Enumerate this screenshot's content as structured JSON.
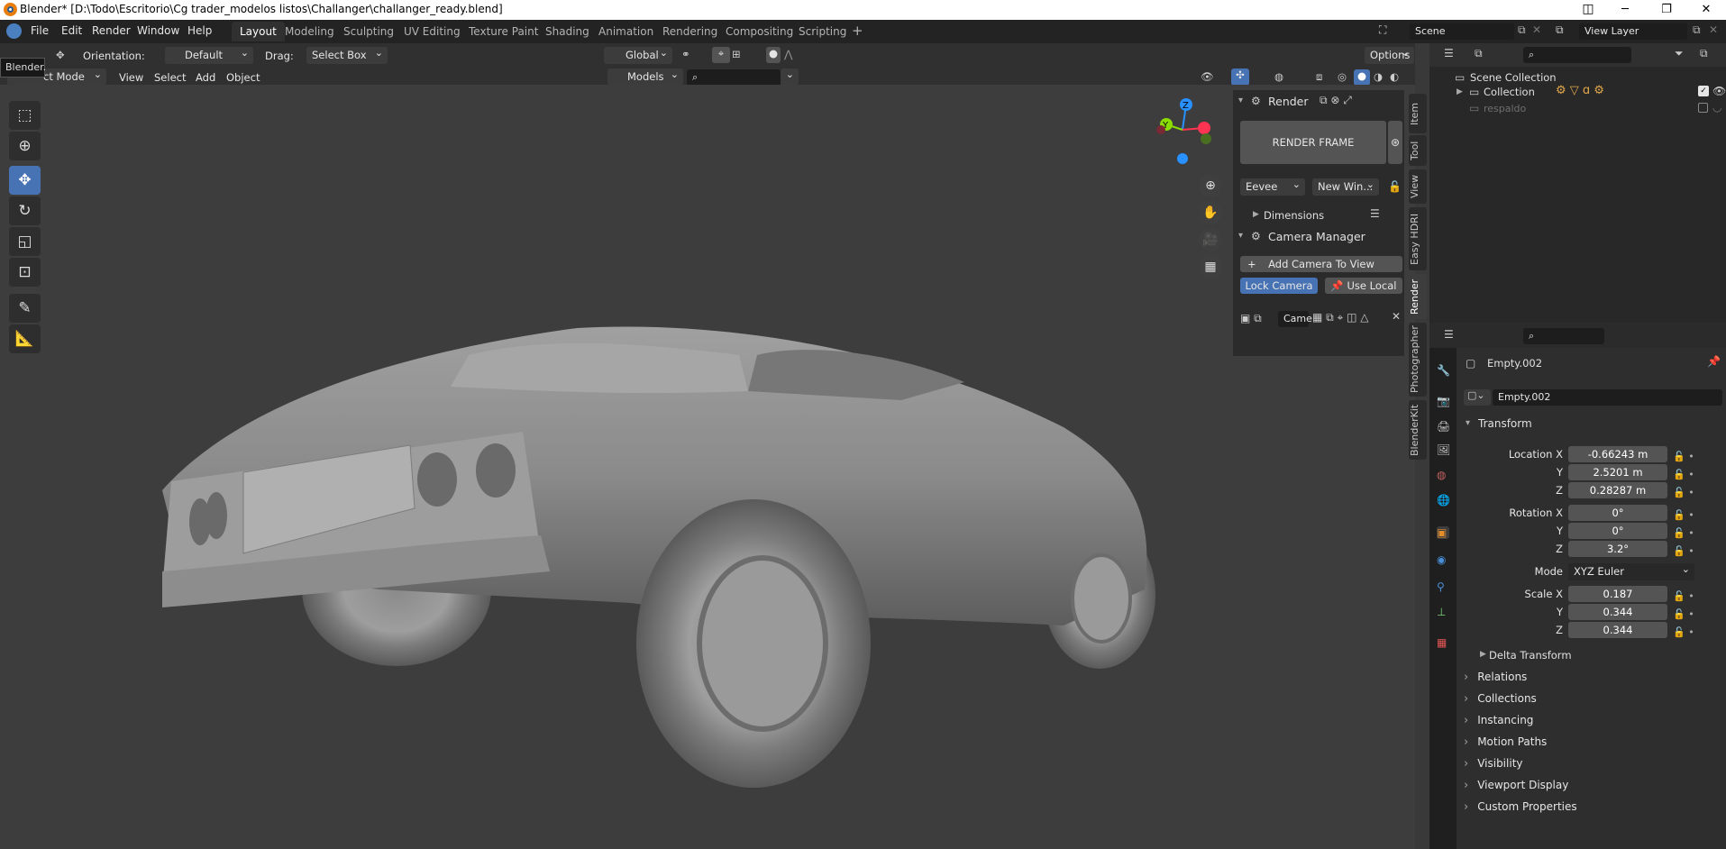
{
  "window": {
    "title": "Blender* [D:\\Todo\\Escritorio\\Cg trader_modelos listos\\Challanger\\challanger_ready.blend]",
    "minimize": "─",
    "restore": "❐",
    "close": "✕"
  },
  "menus": [
    "File",
    "Edit",
    "Render",
    "Window",
    "Help"
  ],
  "workspaces": [
    "Layout",
    "Modeling",
    "Sculpting",
    "UV Editing",
    "Texture Paint",
    "Shading",
    "Animation",
    "Rendering",
    "Compositing",
    "Scripting"
  ],
  "scene": {
    "label": "Scene"
  },
  "view_layer": {
    "label": "View Layer"
  },
  "tool_header": {
    "orientation_label": "Orientation:",
    "orientation_value": "Default",
    "drag_label": "Drag:",
    "drag_value": "Select Box",
    "transform_orientation": "Global",
    "options": "Options"
  },
  "view_header": {
    "mode": "ct Mode",
    "view": "View",
    "select": "Select",
    "add": "Add",
    "object": "Object",
    "collection_filter": "Models"
  },
  "tooltip": "Blender.",
  "render_panel": {
    "title": "Render",
    "render_frame": "RENDER FRAME",
    "engine": "Eevee",
    "output": "New Win...",
    "dimensions": "Dimensions"
  },
  "camera_manager": {
    "title": "Camera Manager",
    "add_camera": "Add Camera To View",
    "lock_camera": "Lock Camera",
    "use_local": "Use Local",
    "camera_field": "Came"
  },
  "side_tabs": [
    "Item",
    "Tool",
    "View",
    "Easy HDRI",
    "Render",
    "Photographer",
    "BlenderKit"
  ],
  "outliner": {
    "scene_collection": "Scene Collection",
    "collection": "Collection",
    "respaldo": "respaldo"
  },
  "properties": {
    "object_name": "Empty.002",
    "data_name": "Empty.002",
    "transform": "Transform",
    "location": {
      "label_x": "Location X",
      "label_y": "Y",
      "label_z": "Z",
      "x": "-0.66243 m",
      "y": "2.5201 m",
      "z": "0.28287 m"
    },
    "rotation": {
      "label_x": "Rotation X",
      "label_y": "Y",
      "label_z": "Z",
      "x": "0°",
      "y": "0°",
      "z": "3.2°"
    },
    "mode": {
      "label": "Mode",
      "value": "XYZ Euler"
    },
    "scale": {
      "label_x": "Scale X",
      "label_y": "Y",
      "label_z": "Z",
      "x": "0.187",
      "y": "0.344",
      "z": "0.344"
    },
    "delta": "Delta Transform",
    "sections": [
      "Relations",
      "Collections",
      "Instancing",
      "Motion Paths",
      "Visibility",
      "Viewport Display",
      "Custom Properties"
    ]
  },
  "gizmo": {
    "x": "X",
    "y": "Y",
    "z": "Z"
  },
  "colors": {
    "accent": "#4772b3",
    "bg": "#3d3d3d",
    "axis_x": "#ff3352",
    "axis_y": "#8bdc00",
    "axis_z": "#2890ff"
  }
}
